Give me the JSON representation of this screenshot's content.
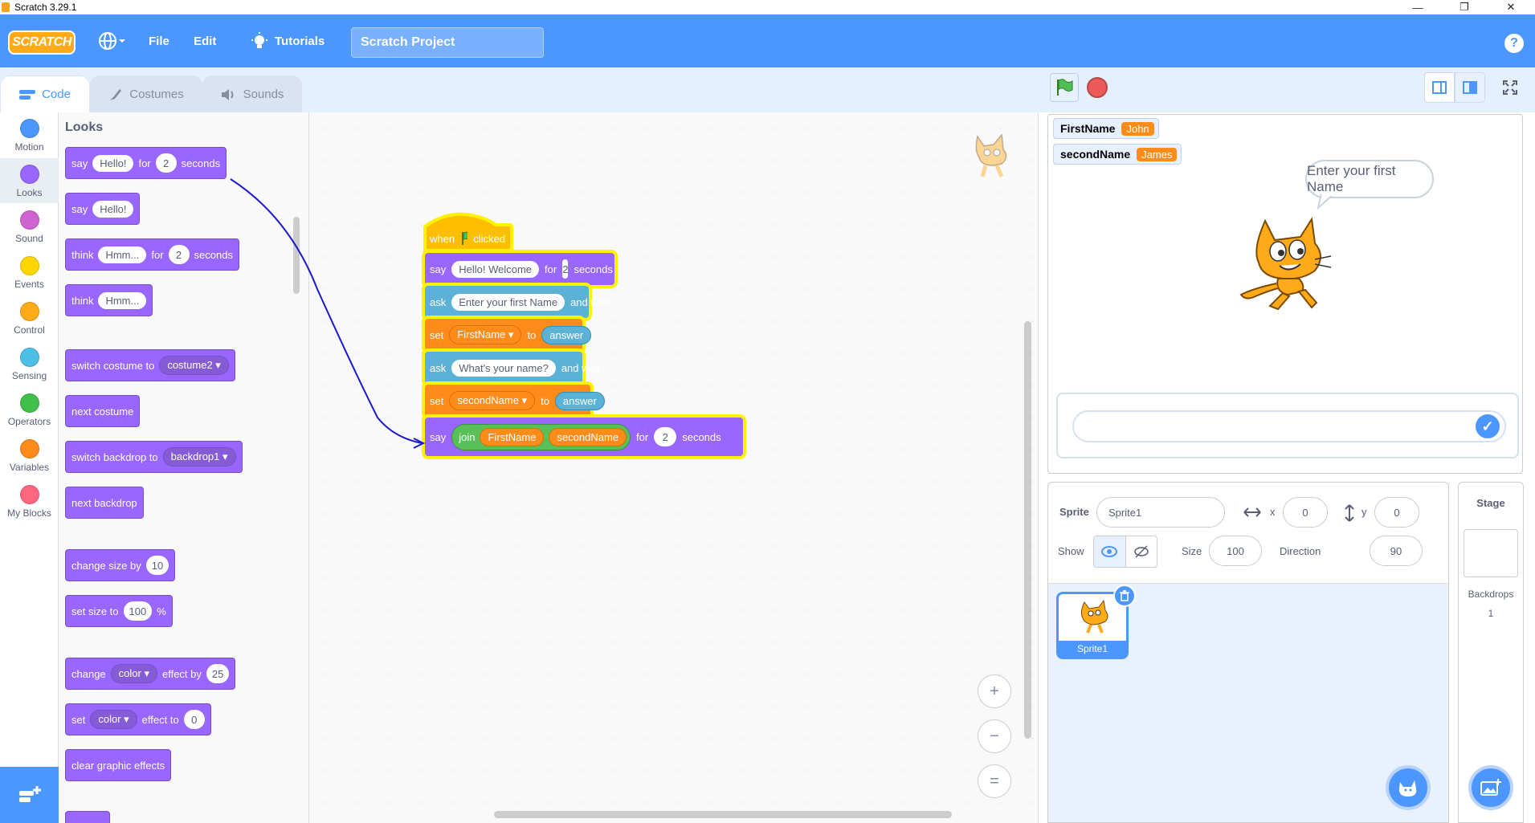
{
  "window": {
    "title": "Scratch 3.29.1",
    "min": "—",
    "max": "❐",
    "close": "✕"
  },
  "menu": {
    "logo": "SCRATCH",
    "file": "File",
    "edit": "Edit",
    "tutorials": "Tutorials",
    "project_title": "Scratch Project",
    "help": "?"
  },
  "tabs": [
    {
      "label": "Code"
    },
    {
      "label": "Costumes"
    },
    {
      "label": "Sounds"
    }
  ],
  "categories": [
    {
      "label": "Motion",
      "color": "#4c97ff"
    },
    {
      "label": "Looks",
      "color": "#9966ff"
    },
    {
      "label": "Sound",
      "color": "#cf63cf"
    },
    {
      "label": "Events",
      "color": "#ffd500"
    },
    {
      "label": "Control",
      "color": "#ffab19"
    },
    {
      "label": "Sensing",
      "color": "#4cbfe6"
    },
    {
      "label": "Operators",
      "color": "#40bf4a"
    },
    {
      "label": "Variables",
      "color": "#ff8c1a"
    },
    {
      "label": "My Blocks",
      "color": "#ff6680"
    }
  ],
  "palette": {
    "title": "Looks",
    "b1": {
      "say": "say",
      "text": "Hello!",
      "for": "for",
      "num": "2",
      "seconds": "seconds"
    },
    "b2": {
      "say": "say",
      "text": "Hello!"
    },
    "b3": {
      "think": "think",
      "text": "Hmm...",
      "for": "for",
      "num": "2",
      "seconds": "seconds"
    },
    "b4": {
      "think": "think",
      "text": "Hmm..."
    },
    "b5": {
      "label": "switch costume to",
      "dd": "costume2 ▾"
    },
    "b6": {
      "label": "next costume"
    },
    "b7": {
      "label": "switch backdrop to",
      "dd": "backdrop1 ▾"
    },
    "b8": {
      "label": "next backdrop"
    },
    "b9": {
      "label": "change size by",
      "num": "10"
    },
    "b10": {
      "label": "set size to",
      "num": "100",
      "pct": "%"
    },
    "b11": {
      "change": "change",
      "dd": "color ▾",
      "effect": "effect by",
      "num": "25"
    },
    "b12": {
      "set": "set",
      "dd": "color ▾",
      "effect": "effect to",
      "num": "0"
    },
    "b13": {
      "label": "clear graphic effects"
    }
  },
  "script": {
    "hat": {
      "when": "when",
      "clicked": "clicked"
    },
    "s1": {
      "say": "say",
      "text": "Hello! Welcome",
      "for": "for",
      "num": "2",
      "seconds": "seconds"
    },
    "s2": {
      "ask": "ask",
      "text": "Enter your first Name",
      "wait": "and wait"
    },
    "s3": {
      "set": "set",
      "var": "FirstName ▾",
      "to": "to",
      "val": "answer"
    },
    "s4": {
      "ask": "ask",
      "text": "What's your name?",
      "wait": "and wait"
    },
    "s5": {
      "set": "set",
      "var": "secondName ▾",
      "to": "to",
      "val": "answer"
    },
    "s6": {
      "say": "say",
      "join": "join",
      "a": "FirstName",
      "b": "secondName",
      "for": "for",
      "num": "2",
      "seconds": "seconds"
    }
  },
  "zoom": {
    "in": "+",
    "out": "−",
    "reset": "="
  },
  "stage": {
    "monitors": [
      {
        "name": "FirstName",
        "value": "John"
      },
      {
        "name": "secondName",
        "value": "James"
      }
    ],
    "bubble": "Enter your first Name"
  },
  "sprite_info": {
    "sprite_label": "Sprite",
    "sprite_name": "Sprite1",
    "x_label": "x",
    "x_val": "0",
    "y_label": "y",
    "y_val": "0",
    "show_label": "Show",
    "size_label": "Size",
    "size_val": "100",
    "dir_label": "Direction",
    "dir_val": "90",
    "thumb_name": "Sprite1"
  },
  "stage_pane": {
    "title": "Stage",
    "backdrops_label": "Backdrops",
    "backdrops_count": "1"
  }
}
